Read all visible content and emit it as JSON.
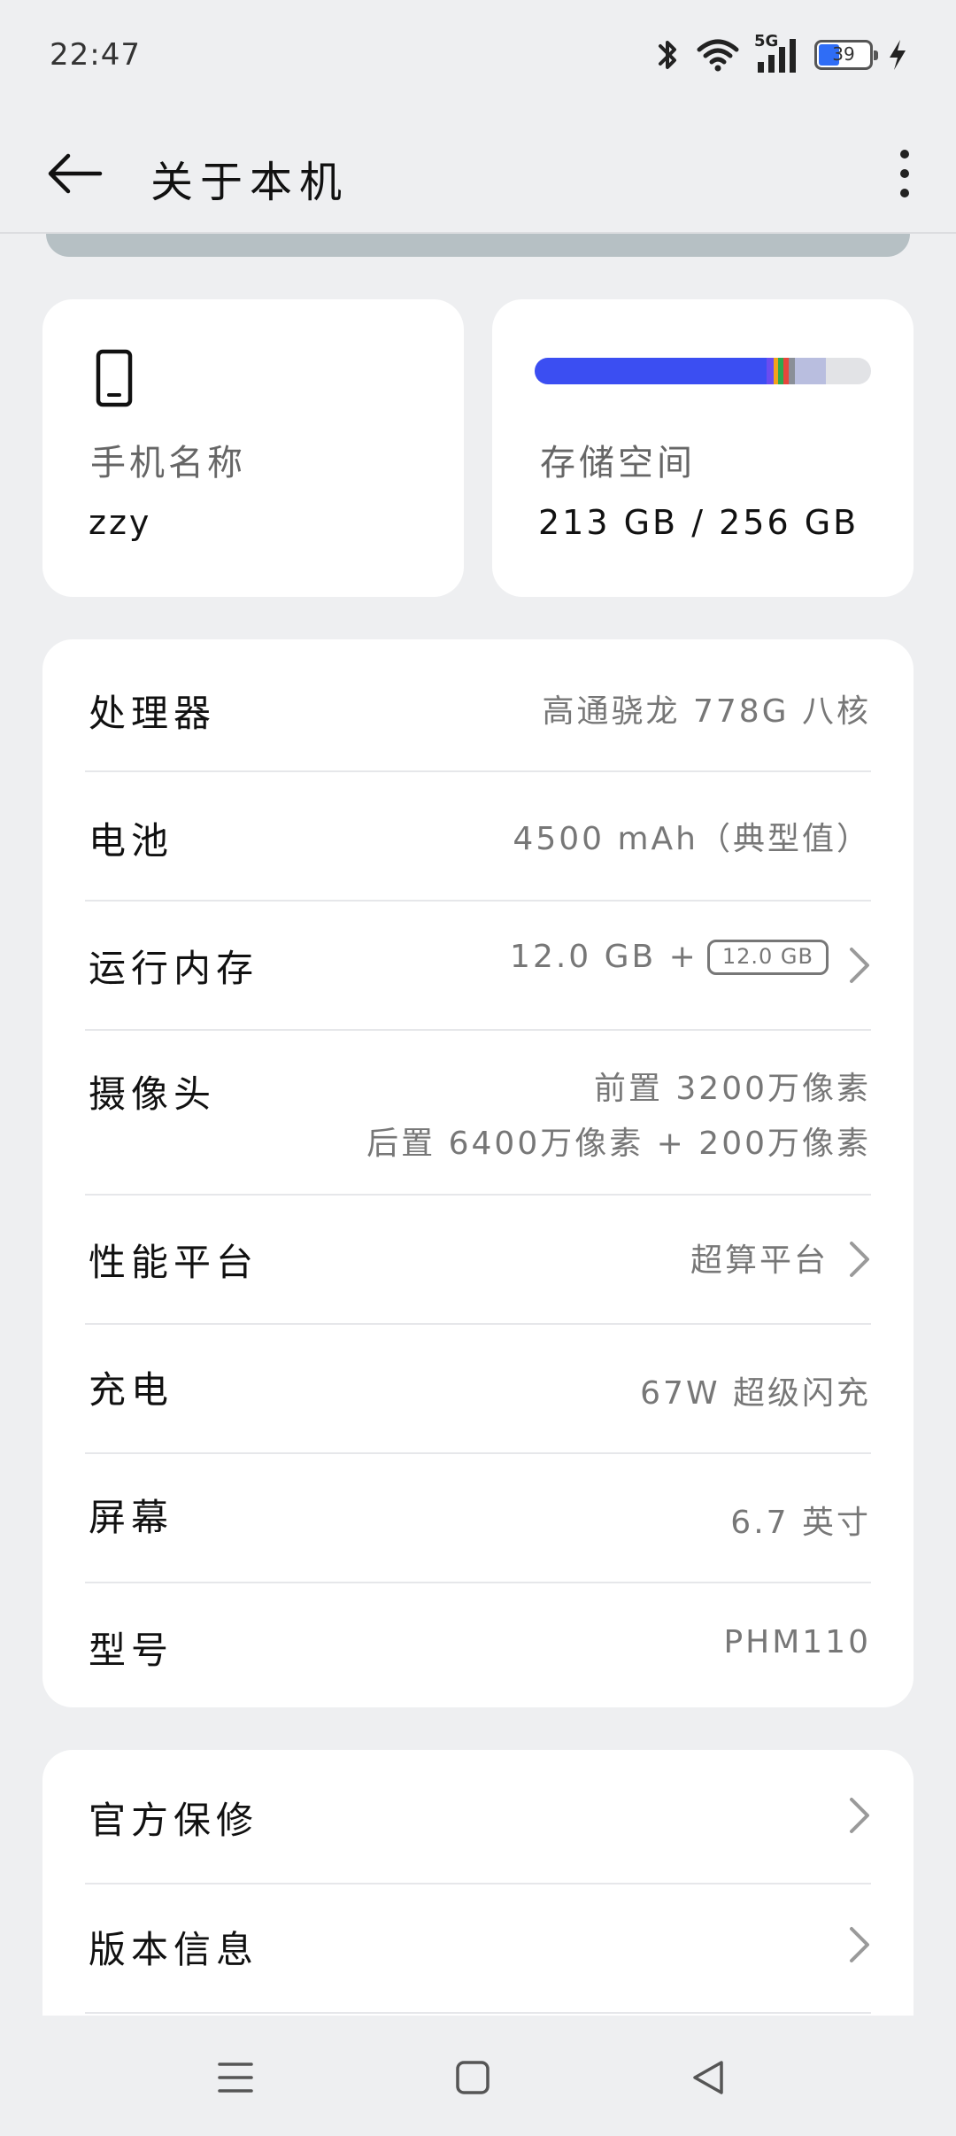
{
  "status_bar": {
    "time": "22:47",
    "network": "5G",
    "battery_level": "39",
    "icons": [
      "bluetooth-icon",
      "wifi-icon",
      "signal-5g-icon",
      "battery-icon",
      "charging-icon"
    ]
  },
  "header": {
    "title": "关于本机",
    "back_icon": "arrow-left-icon",
    "more_icon": "more-vertical-icon"
  },
  "device_card": {
    "icon": "phone-icon",
    "label": "手机名称",
    "value": "zzy"
  },
  "storage_card": {
    "label": "存储空间",
    "value": "213 GB / 256 GB",
    "used_fraction": 0.832,
    "segments": [
      {
        "color": "#3b4ef2",
        "share": 0.69
      },
      {
        "color": "#6a4cf0",
        "share": 0.02
      },
      {
        "color": "#f2a31b",
        "share": 0.015
      },
      {
        "color": "#2ea84f",
        "share": 0.015
      },
      {
        "color": "#e8453c",
        "share": 0.015
      },
      {
        "color": "#8a8f98",
        "share": 0.02
      },
      {
        "color": "#b9bedf",
        "share": 0.09
      }
    ]
  },
  "specs": {
    "processor": {
      "label": "处理器",
      "value": "高通骁龙 778G 八核"
    },
    "battery": {
      "label": "电池",
      "value": "4500 mAh（典型值）"
    },
    "ram": {
      "label": "运行内存",
      "value": "12.0 GB +",
      "badge": "12.0 GB"
    },
    "camera": {
      "label": "摄像头",
      "front": "前置 3200万像素",
      "rear": "后置 6400万像素 + 200万像素"
    },
    "performance": {
      "label": "性能平台",
      "value": "超算平台"
    },
    "charging": {
      "label": "充电",
      "value": "67W 超级闪充"
    },
    "screen": {
      "label": "屏幕",
      "value": "6.7 英寸"
    },
    "model": {
      "label": "型号",
      "value": "PHM110"
    }
  },
  "menu": {
    "warranty": "官方保修",
    "version": "版本信息"
  },
  "nav": {
    "icons": [
      "menu-icon",
      "home-square-icon",
      "back-triangle-icon"
    ]
  },
  "colors": {
    "background": "#eeeff1",
    "card": "#ffffff",
    "accent_blue": "#3b4ef2",
    "secondary_text": "#777777"
  }
}
